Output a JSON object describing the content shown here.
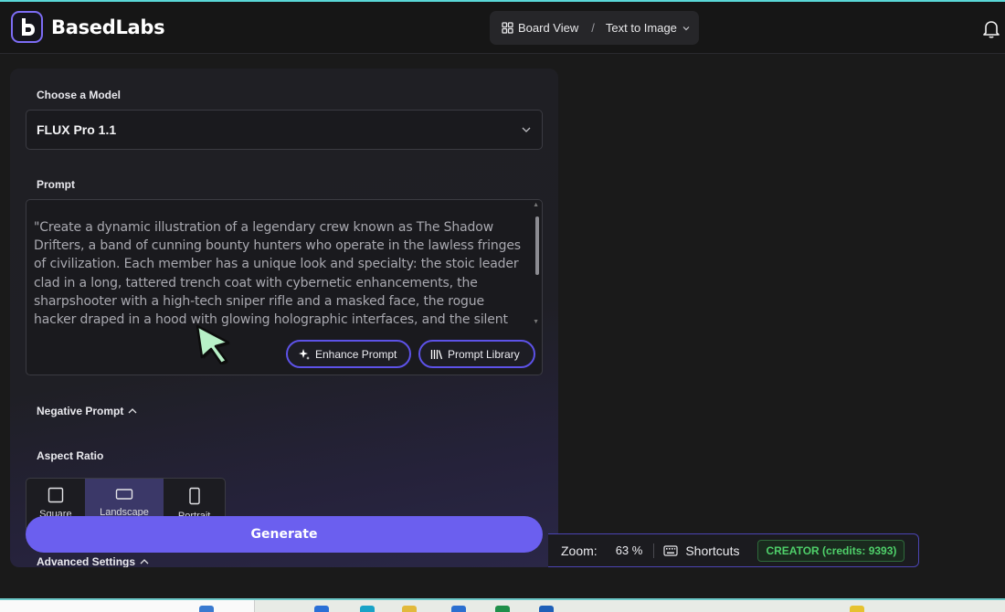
{
  "app": {
    "name": "BasedLabs",
    "accent": "#6b5fef"
  },
  "breadcrumb": {
    "board_view": "Board View",
    "separator": "/",
    "current": "Text to Image"
  },
  "model": {
    "label": "Choose a Model",
    "selected": "FLUX Pro 1.1"
  },
  "prompt": {
    "label": "Prompt",
    "value": "\"Create a dynamic illustration of a legendary crew known as The Shadow Drifters, a band of cunning bounty hunters who operate in the lawless fringes of civilization. Each member has a unique look and specialty: the stoic leader clad in a long, tattered trench coat with cybernetic enhancements, the sharpshooter with a high-tech sniper rifle and a masked face, the rogue hacker draped in a hood with glowing holographic interfaces, and the silent blade master wielding",
    "enhance_label": "Enhance Prompt",
    "library_label": "Prompt Library"
  },
  "negative_prompt": {
    "label": "Negative Prompt"
  },
  "aspect_ratio": {
    "label": "Aspect Ratio",
    "options": [
      {
        "label": "Square",
        "active": false
      },
      {
        "label": "Landscape",
        "active": true
      },
      {
        "label": "Portrait",
        "active": false
      }
    ]
  },
  "generate_label": "Generate",
  "advanced_label": "Advanced Settings",
  "status": {
    "zoom_label": "Zoom:",
    "zoom_value": "63 %",
    "shortcuts_label": "Shortcuts",
    "plan_badge": "CREATOR (credits: 9393)",
    "badge_color": "#4fd06a"
  }
}
